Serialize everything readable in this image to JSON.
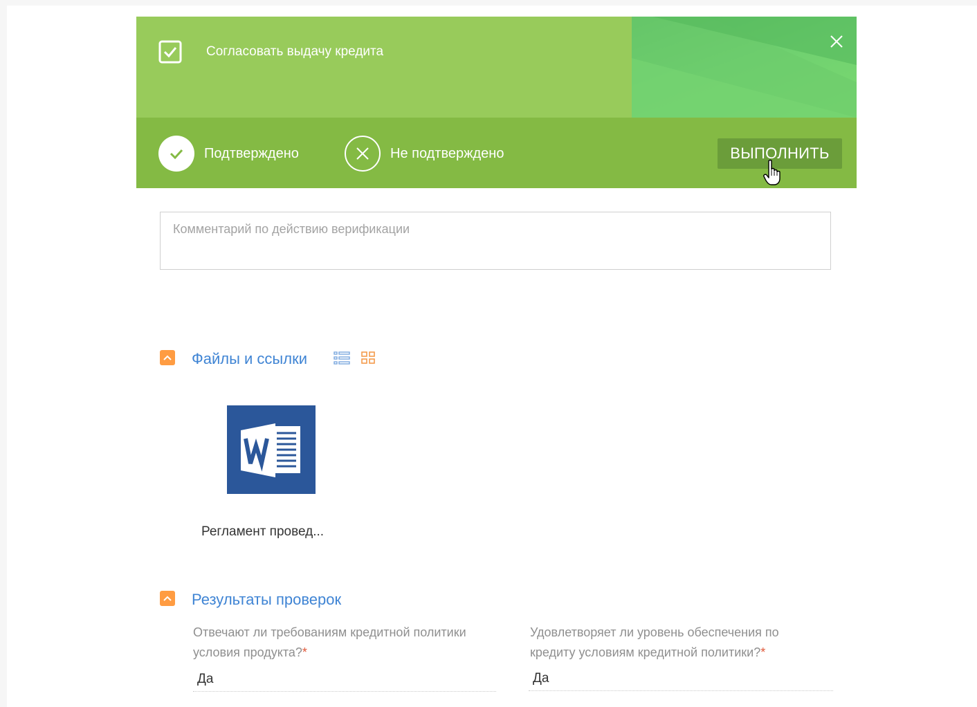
{
  "header": {
    "title": "Согласовать выдачу кредита",
    "check_icon": "checkbox-checked-icon",
    "close_icon": "close-icon"
  },
  "actions": {
    "confirm_label": "Подтверждено",
    "reject_label": "Не подтверждено",
    "execute_label": "ВЫПОЛНИТЬ"
  },
  "comment": {
    "placeholder": "Комментарий по действию верификации",
    "value": ""
  },
  "files_section": {
    "title": "Файлы и ссылки",
    "list_view_icon": "list-view-icon",
    "tile_view_icon": "tile-view-icon",
    "files": [
      {
        "name": "Регламент провед...",
        "icon": "word-document-icon"
      }
    ]
  },
  "results_section": {
    "title": "Результаты проверок",
    "fields": [
      {
        "label": "Отвечают ли требованиям кредитной политики условия продукта?",
        "required_mark": "*",
        "value": "Да"
      },
      {
        "label": "Удовлетворяет ли уровень обеспечения по кредиту условиям кредитной политики?",
        "required_mark": "*",
        "value": "Да"
      }
    ]
  },
  "colors": {
    "header_green": "#98cb5b",
    "action_bar_green": "#84ba44",
    "execute_button": "#6b9d3a",
    "accent_orange": "#ff9c42",
    "link_blue": "#3f84d4",
    "word_blue": "#2b579a"
  }
}
